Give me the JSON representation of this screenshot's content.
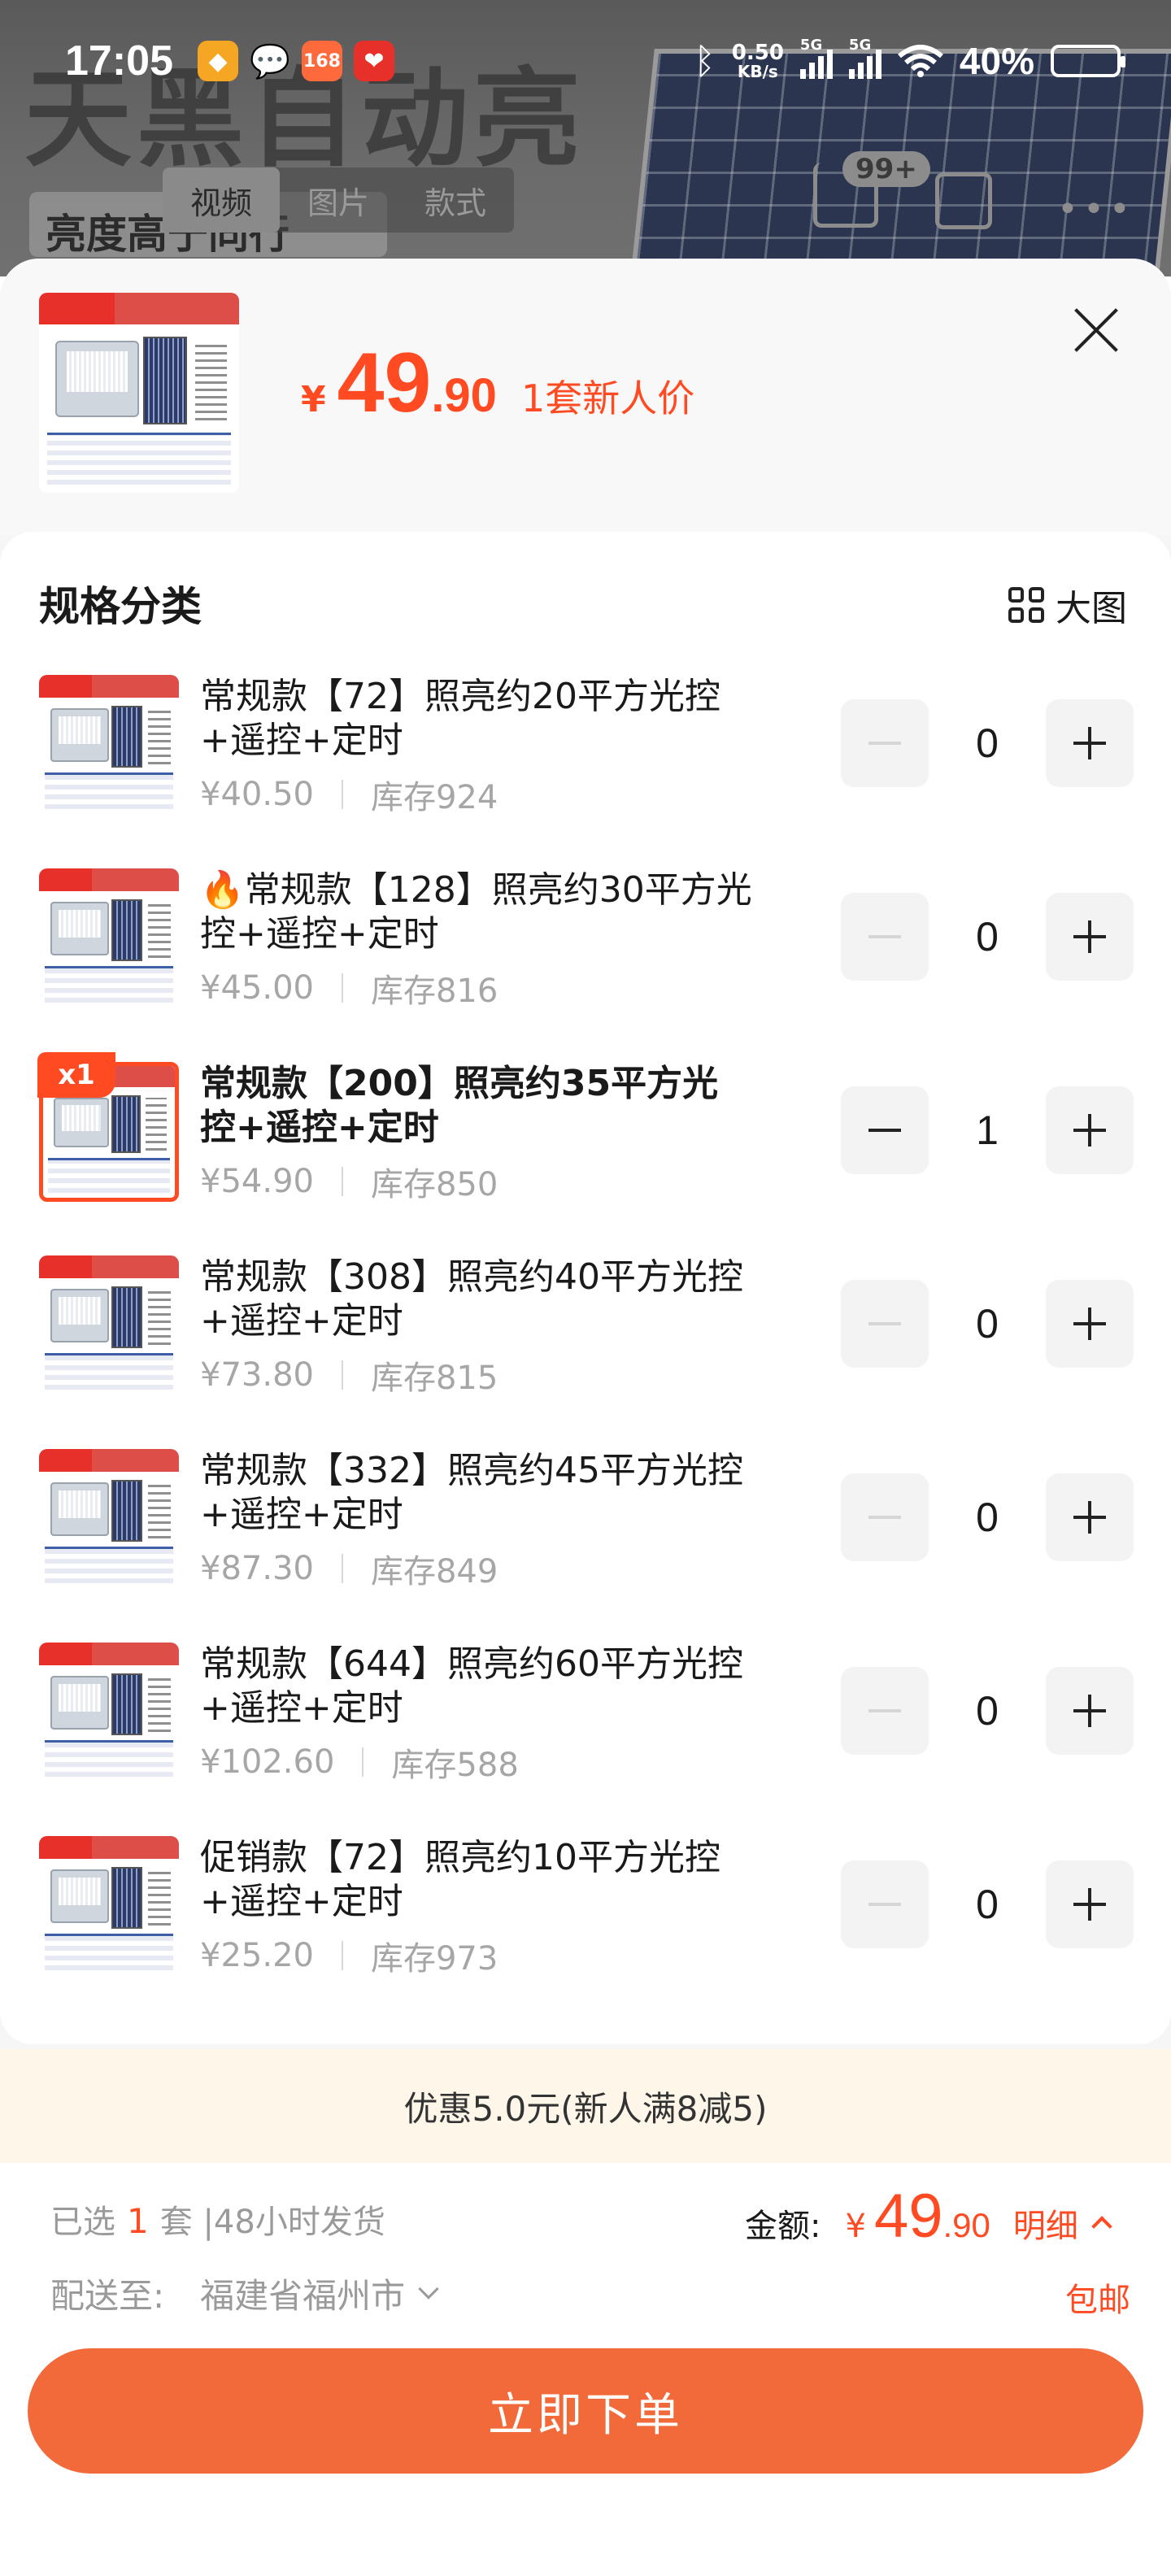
{
  "status_bar": {
    "time": "17:05",
    "net_speed_value": "0.50",
    "net_speed_unit": "KB/s",
    "signal1_tag": "5G",
    "signal2_tag": "5G",
    "battery_percent": "40%",
    "battery_level": 0.4,
    "app_icons": [
      "app-icon-orange",
      "wechat-icon",
      "app-icon-red-168",
      "app-icon-red-heart"
    ]
  },
  "background_page": {
    "banner_text": "天黑自动亮",
    "sub_banner_text": "亮度高于同行",
    "media_tabs": [
      "视频",
      "图片",
      "款式"
    ],
    "active_tab": 0,
    "cart_badge": "99+"
  },
  "sheet": {
    "header": {
      "currency": "¥",
      "price_int": "49",
      "price_dec": ".90",
      "price_note": "1套新人价"
    },
    "spec_title": "规格分类",
    "big_picture_label": "大图",
    "items": [
      {
        "name": "常规款【72】照亮约20平方光控+遥控+定时",
        "price": "¥40.50",
        "stock": "库存924",
        "qty": "0",
        "selected": false,
        "fire": ""
      },
      {
        "name": "常规款【128】照亮约30平方光控+遥控+定时",
        "price": "¥45.00",
        "stock": "库存816",
        "qty": "0",
        "selected": false,
        "fire": "🔥"
      },
      {
        "name": "常规款【200】照亮约35平方光控+遥控+定时",
        "price": "¥54.90",
        "stock": "库存850",
        "qty": "1",
        "selected": true,
        "badge": "x1",
        "fire": ""
      },
      {
        "name": "常规款【308】照亮约40平方光控+遥控+定时",
        "price": "¥73.80",
        "stock": "库存815",
        "qty": "0",
        "selected": false,
        "fire": ""
      },
      {
        "name": "常规款【332】照亮约45平方光控+遥控+定时",
        "price": "¥87.30",
        "stock": "库存849",
        "qty": "0",
        "selected": false,
        "fire": ""
      },
      {
        "name": "常规款【644】照亮约60平方光控+遥控+定时",
        "price": "¥102.60",
        "stock": "库存588",
        "qty": "0",
        "selected": false,
        "fire": ""
      },
      {
        "name": "促销款【72】照亮约10平方光控+遥控+定时",
        "price": "¥25.20",
        "stock": "库存973",
        "qty": "0",
        "selected": false,
        "fire": ""
      }
    ]
  },
  "promo": {
    "text": "优惠5.0元(新人满8减5)"
  },
  "footer": {
    "selected_prefix": "已选",
    "selected_count": "1",
    "selected_suffix": "套 |48小时发货",
    "amount_label": "金额:",
    "amount_currency": "¥",
    "amount_int": "49",
    "amount_dec": ".90",
    "detail_label": "明细",
    "ship_to_label": "配送至:",
    "ship_to_city": "福建省福州市",
    "free_shipping": "包邮",
    "order_button": "立即下单"
  },
  "colors": {
    "accent": "#ff4a22",
    "button": "#f26a3a",
    "promo_bg": "#fdf6e9"
  }
}
